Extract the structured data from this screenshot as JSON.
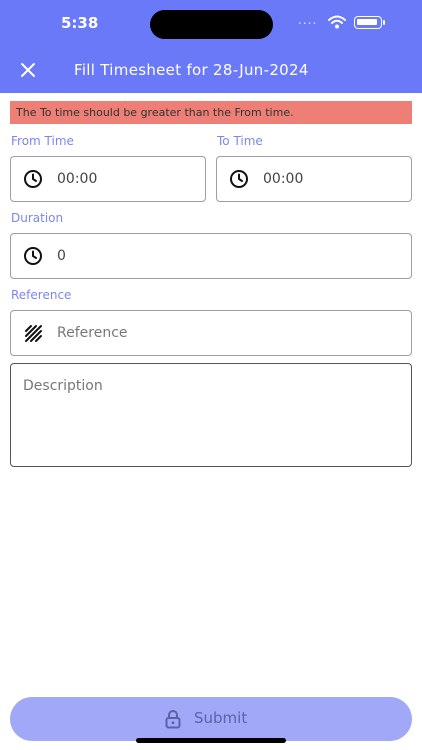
{
  "status_bar": {
    "time": "5:38",
    "signal": "...."
  },
  "header": {
    "title": "Fill Timesheet for 28-Jun-2024",
    "close_icon": "close-icon"
  },
  "error": {
    "message": "The To time should be greater than the From time."
  },
  "form": {
    "from_time": {
      "label": "From Time",
      "value": "00:00",
      "icon": "clock-icon"
    },
    "to_time": {
      "label": "To Time",
      "value": "00:00",
      "icon": "clock-icon"
    },
    "duration": {
      "label": "Duration",
      "value": "0",
      "icon": "clock-icon"
    },
    "reference": {
      "label": "Reference",
      "placeholder": "Reference",
      "value": "",
      "icon": "stripes-icon"
    },
    "description": {
      "placeholder": "Description",
      "value": ""
    }
  },
  "submit": {
    "label": "Submit",
    "icon": "lock-icon"
  },
  "colors": {
    "header": "#6a79f7",
    "error_bg": "#ee7f76",
    "label": "#7b87ee",
    "submit_bg": "#a0a8f7"
  }
}
